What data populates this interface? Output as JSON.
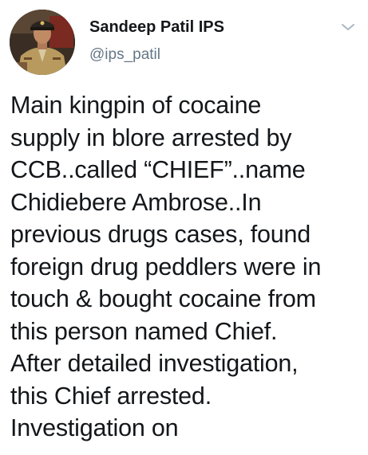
{
  "author": {
    "display_name": "Sandeep Patil IPS",
    "handle": "@ips_patil",
    "avatar_icon": "profile-photo-uniformed-officer"
  },
  "menu": {
    "icon": "chevron-down-icon"
  },
  "tweet": {
    "lines": [
      "Main kingpin of cocaine",
      "supply in blore arrested by",
      "CCB..called “CHIEF”..name",
      "Chidiebere Ambrose..In",
      "previous drugs cases, found",
      "foreign drug peddlers were in",
      "touch & bought cocaine from",
      "this person named Chief.",
      "After detailed investigation,",
      "this Chief arrested.",
      "Investigation on"
    ]
  },
  "colors": {
    "text": "#14171a",
    "secondary": "#657786",
    "chevron": "#aab8c2"
  }
}
